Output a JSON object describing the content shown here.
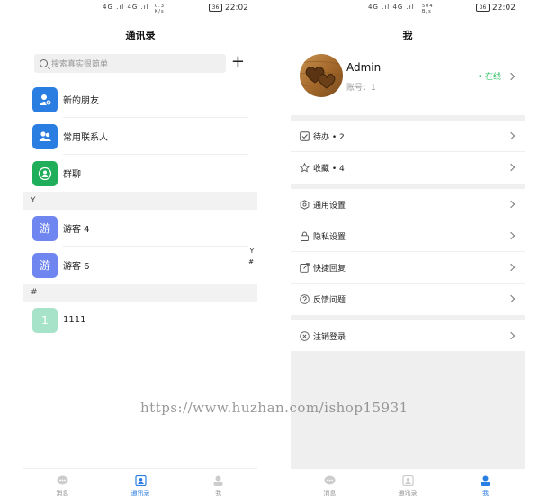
{
  "left_screen": {
    "status": {
      "signal": "4G .ıl 4G .ıl",
      "net": "0.3 K/s",
      "battery": "36",
      "time": "22:02"
    },
    "title": "通讯录",
    "search": {
      "placeholder": "搜索真实很简单",
      "add_label": "+"
    },
    "contacts_top": [
      {
        "name": "新的朋友",
        "avatar_color": "#2a7de1",
        "icon": "add-friend-icon"
      },
      {
        "name": "常用联系人",
        "avatar_color": "#2a7de1",
        "icon": "contacts-icon"
      },
      {
        "name": "群聊",
        "avatar_color": "#1fae5a",
        "icon": "group-chat-icon"
      }
    ],
    "section_y": "Y",
    "contacts_y": [
      {
        "name": "游客 4",
        "avatar_text": "游",
        "avatar_color": "#6f86f0"
      },
      {
        "name": "游客 6",
        "avatar_text": "游",
        "avatar_color": "#6f86f0"
      }
    ],
    "section_hash": "#",
    "contacts_hash": [
      {
        "name": "1111",
        "avatar_text": "1",
        "avatar_color": "#a7e3c8"
      }
    ],
    "index_letters": [
      "Y",
      "#"
    ]
  },
  "right_screen": {
    "status": {
      "signal": "4G .ıl 4G .ıl",
      "net": "504 B/s",
      "battery": "36",
      "time": "22:02"
    },
    "title": "我",
    "profile": {
      "name": "Admin",
      "account": "账号：1",
      "status": "• 在线"
    },
    "menu": [
      {
        "label": "待办 • 2",
        "icon": "todo-check-icon"
      },
      {
        "label": "收藏 • 4",
        "icon": "star-icon"
      },
      {
        "label": "通用设置",
        "icon": "settings-gear-icon"
      },
      {
        "label": "隐私设置",
        "icon": "lock-icon"
      },
      {
        "label": "快捷回复",
        "icon": "quick-reply-icon"
      },
      {
        "label": "反馈问题",
        "icon": "question-icon"
      },
      {
        "label": "注销登录",
        "icon": "logout-icon"
      }
    ]
  },
  "tabs": [
    {
      "label": "消息",
      "icon": "chat-bubble-icon"
    },
    {
      "label": "通讯录",
      "icon": "contacts-book-icon"
    },
    {
      "label": "我",
      "icon": "person-icon"
    }
  ],
  "watermark": "https://www.huzhan.com/ishop15931",
  "colors": {
    "accent": "#2a7de1",
    "online": "#35c26b"
  }
}
